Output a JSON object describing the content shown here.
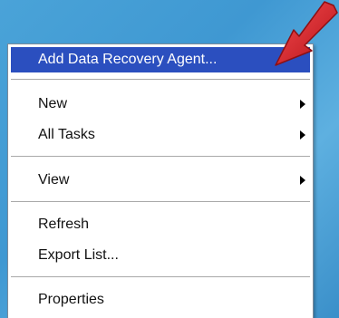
{
  "context_menu": {
    "items": [
      {
        "label": "Add Data Recovery Agent...",
        "selected": true,
        "has_submenu": false
      },
      {
        "label": "New",
        "has_submenu": true
      },
      {
        "label": "All Tasks",
        "has_submenu": true
      },
      {
        "label": "View",
        "has_submenu": true
      },
      {
        "label": "Refresh",
        "has_submenu": false
      },
      {
        "label": "Export List...",
        "has_submenu": false
      },
      {
        "label": "Properties",
        "has_submenu": false
      }
    ]
  },
  "colors": {
    "desktop_background": "#4aa3d8",
    "selection_highlight": "#2b4fbf",
    "annotation_arrow": "#d9262b"
  },
  "icons": {
    "submenu_indicator": "triangle-right-icon",
    "annotation": "red-arrow-icon"
  }
}
